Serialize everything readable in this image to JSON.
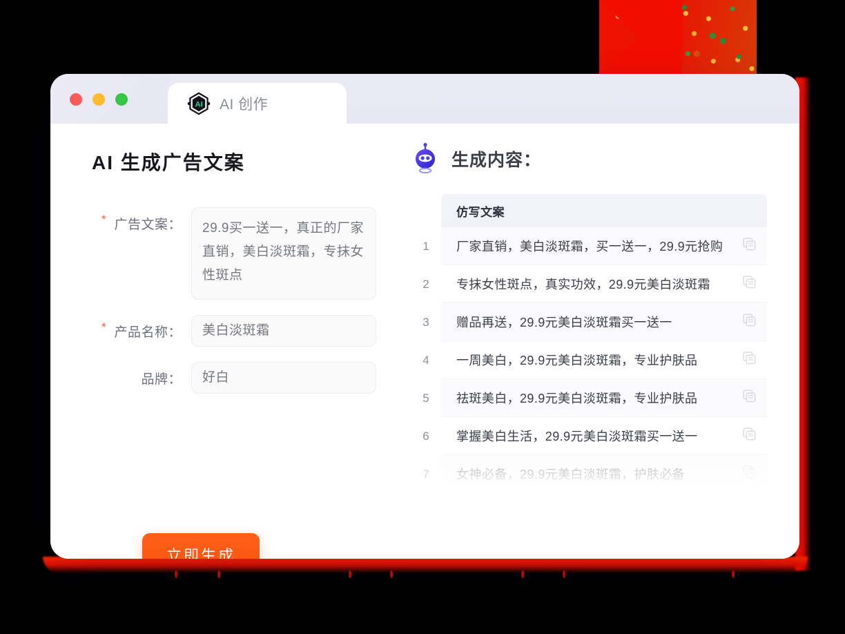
{
  "window": {
    "traffic_lights": [
      {
        "name": "close",
        "color": "#fc5b5b"
      },
      {
        "name": "minimize",
        "color": "#fcbb2d"
      },
      {
        "name": "maximize",
        "color": "#34c748"
      }
    ],
    "tab": {
      "label": "AI 创作",
      "icon": "ai-hexagon-logo"
    }
  },
  "left_panel": {
    "title": "AI 生成广告文案",
    "fields": [
      {
        "label": "广告文案：",
        "required": true,
        "value": "29.9买一送一，真正的厂家直销，美白淡斑霜，专抹女性斑点",
        "type": "textarea"
      },
      {
        "label": "产品名称：",
        "required": true,
        "value": "美白淡斑霜",
        "type": "input"
      },
      {
        "label": "品牌：",
        "required": false,
        "value": "好白",
        "type": "input"
      }
    ],
    "submit_label": "立即生成"
  },
  "right_panel": {
    "heading": "生成内容：",
    "robot_icon": "robot-head-icon",
    "column_header": "仿写文案",
    "rows": [
      {
        "num": "1",
        "text": "厂家直销，美白淡斑霜，买一送一，29.9元抢购",
        "faded": false
      },
      {
        "num": "2",
        "text": "专抹女性斑点，真实功效，29.9元美白淡斑霜",
        "faded": false
      },
      {
        "num": "3",
        "text": "赠品再送，29.9元美白淡斑霜买一送一",
        "faded": false
      },
      {
        "num": "4",
        "text": "一周美白，29.9元美白淡斑霜，专业护肤品",
        "faded": false
      },
      {
        "num": "5",
        "text": "祛斑美白，29.9元美白淡斑霜，专业护肤品",
        "faded": false
      },
      {
        "num": "6",
        "text": "掌握美白生活，29.9元美白淡斑霜买一送一",
        "faded": false
      },
      {
        "num": "7",
        "text": "女神必备，29.9元美白淡斑霜，护肤必备",
        "faded": true
      }
    ],
    "copy_icon": "copy-icon"
  },
  "colors": {
    "accent_orange": "#fa550f",
    "required_star": "#ff5a2e",
    "logo_green": "#16d98a",
    "robot_blue": "#4a3fe0",
    "decor_red": "#f20d00"
  }
}
